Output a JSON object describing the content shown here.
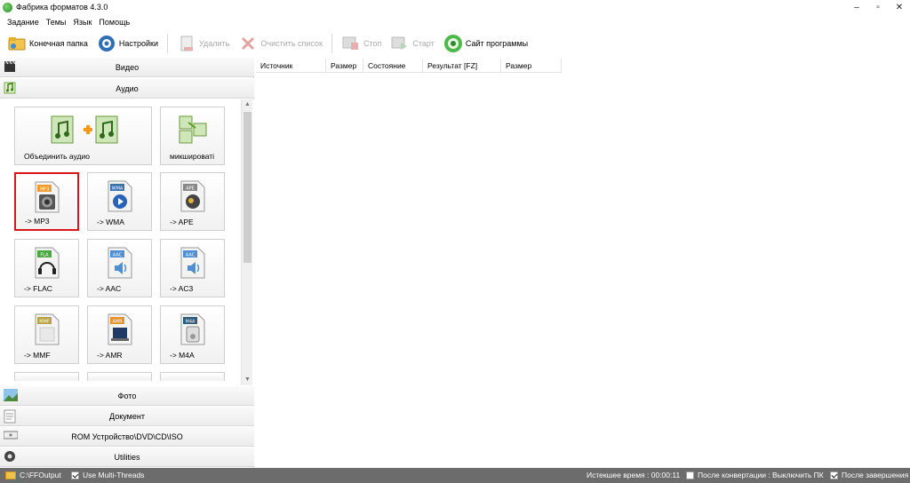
{
  "window": {
    "title": "Фабрика форматов 4.3.0",
    "minimize": "–",
    "restore": "▫",
    "close": "✕"
  },
  "menu": [
    "Задание",
    "Темы",
    "Язык",
    "Помощь"
  ],
  "toolbar": {
    "output_folder": "Конечная папка",
    "settings": "Настройки",
    "remove": "Удалить",
    "clear_list": "Очистить список",
    "stop": "Стоп",
    "start": "Старт",
    "website": "Сайт программы"
  },
  "categories": {
    "video": "Видео",
    "audio": "Аудио",
    "photo": "Фото",
    "document": "Документ",
    "rom": "ROM Устройство\\DVD\\CD\\ISO",
    "utilities": "Utilities"
  },
  "audio_tiles": {
    "join_audio": "Объединить аудио",
    "mix": "микшироватi",
    "mp3": "-> MP3",
    "wma": "-> WMA",
    "ape": "-> APE",
    "flac": "-> FLAC",
    "aac": "-> AAC",
    "ac3": "-> AC3",
    "mmf": "-> MMF",
    "amr": "-> AMR",
    "m4a": "-> M4A"
  },
  "badges": {
    "mp3": "MP3",
    "wma": "WMA",
    "ape": "APE",
    "flac": "FLA",
    "aac": "AAC",
    "ac3": "AAC",
    "mmf": "MMF",
    "amr": "AMR",
    "m4a": "M4A"
  },
  "list_columns": [
    "Источник",
    "Размер",
    "Состояние",
    "Результат [FZ]",
    "Размер"
  ],
  "status": {
    "output_path": "C:\\FFOutput",
    "multithreads": "Use Multi-Threads",
    "elapsed": "Истекшее время : 00:00:11",
    "after_convert": "После конвертации : Выключить ПК",
    "after_finish": "После завершения"
  },
  "colors": {
    "accent_red": "#d9141a",
    "status_bg": "#6c6c6c"
  }
}
